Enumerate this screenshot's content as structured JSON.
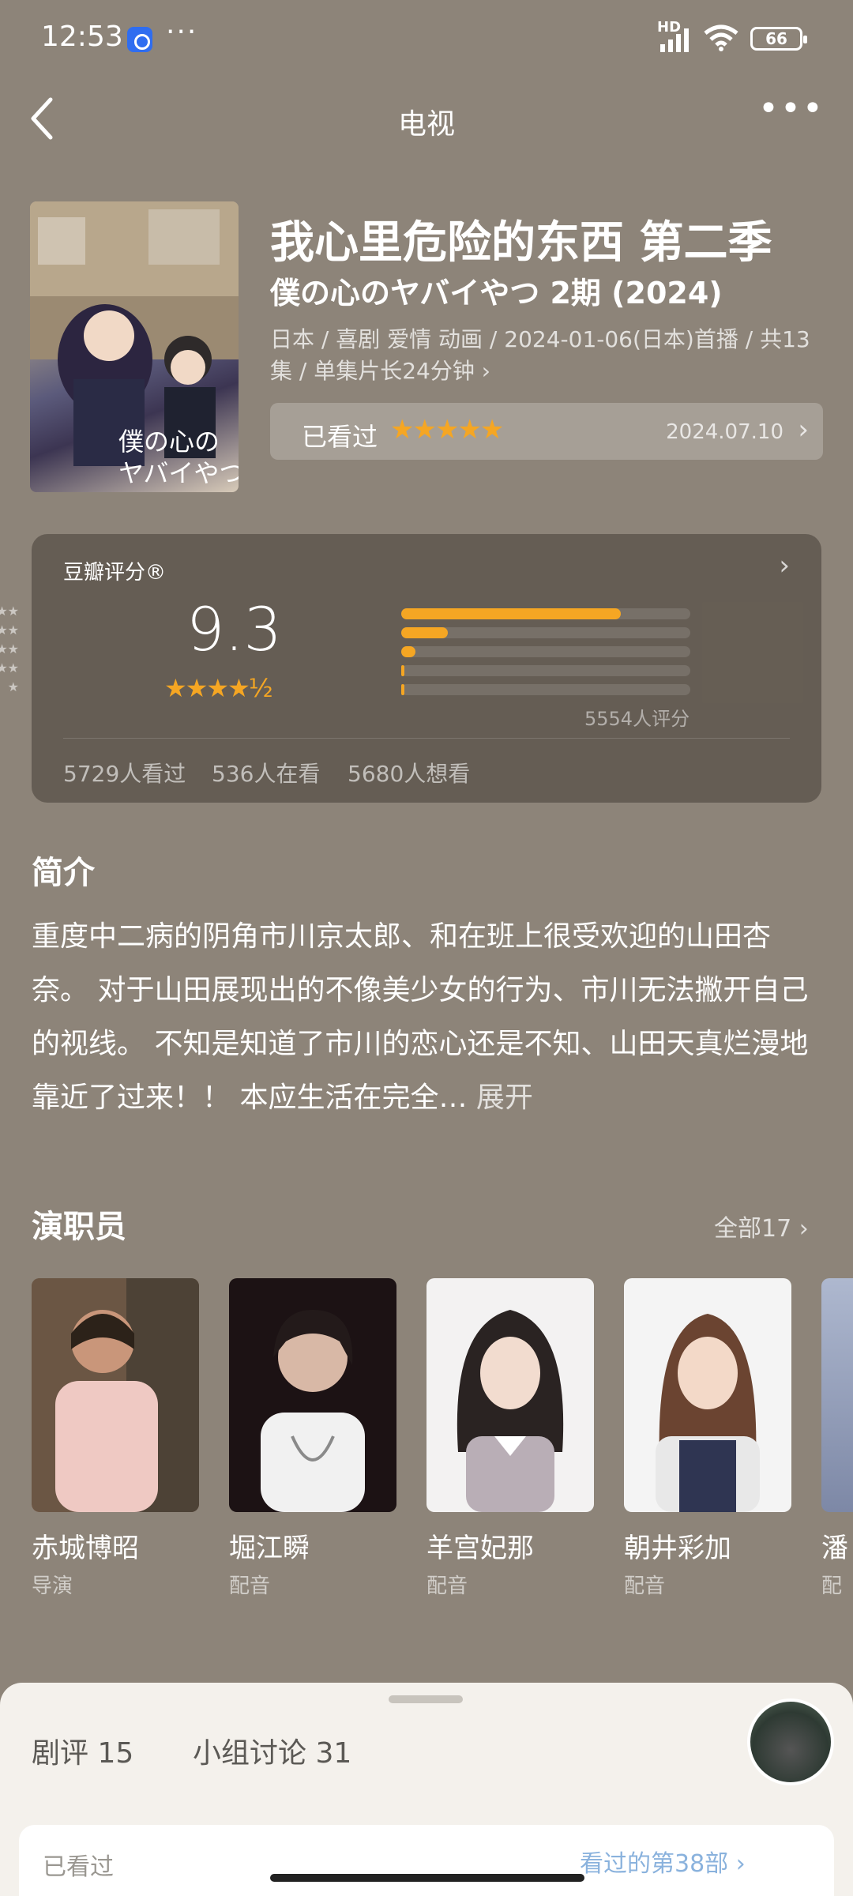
{
  "status_bar": {
    "time": "12:53",
    "dots": "···",
    "network": "HD",
    "battery": "66"
  },
  "header": {
    "title": "电视",
    "more": "•••"
  },
  "show": {
    "title_cn": "我心里危险的东西 第二季",
    "title_jp": "僕の心のヤバイやつ 2期 (2024)",
    "meta": "日本 / 喜剧 爱情 动画 / 2024-01-06(日本)首播 / 共13集 / 单集片长24分钟 ›",
    "poster_text": "僕の心のヤバイやつ"
  },
  "watched": {
    "label": "已看过",
    "stars": "★★★★★",
    "date": "2024.07.10",
    "chevron": "›"
  },
  "rating": {
    "label": "豆瓣评分®",
    "chevron": "›",
    "score": "9.3",
    "stars": "★★★★½",
    "distribution": [
      {
        "stars": "★★★★★",
        "fraction": 0.76
      },
      {
        "stars": "★★★★",
        "fraction": 0.16
      },
      {
        "stars": "★★★",
        "fraction": 0.05
      },
      {
        "stars": "★★",
        "fraction": 0.01
      },
      {
        "stars": "★",
        "fraction": 0.01
      }
    ],
    "count": "5554人评分",
    "watched": "5729人看过",
    "watching": "536人在看",
    "want": "5680人想看"
  },
  "intro": {
    "heading": "简介",
    "text": "重度中二病的阴角市川京太郎、和在班上很受欢迎的山田杏奈。 对于山田展现出的不像美少女的行为、市川无法撇开自己的视线。 不知是知道了市川的恋心还是不知、山田天真烂漫地靠近了过来！！ 本应生活在完全…",
    "expand": "展开"
  },
  "cast": {
    "heading": "演职员",
    "all_label": "全部17 ›",
    "members": [
      {
        "name": "赤城博昭",
        "role": "导演"
      },
      {
        "name": "堀江瞬",
        "role": "配音"
      },
      {
        "name": "羊宫妃那",
        "role": "配音"
      },
      {
        "name": "朝井彩加",
        "role": "配音"
      },
      {
        "name": "潘",
        "role": "配"
      }
    ]
  },
  "sheet": {
    "tab_reviews": "剧评 15",
    "tab_groups": "小组讨论 31",
    "row_left": "已看过",
    "row_right": "看过的第38部 ›"
  },
  "colors": {
    "background": "#8d8479",
    "accent_star": "#f5a623",
    "sheet_bg": "#f4f1ec"
  }
}
